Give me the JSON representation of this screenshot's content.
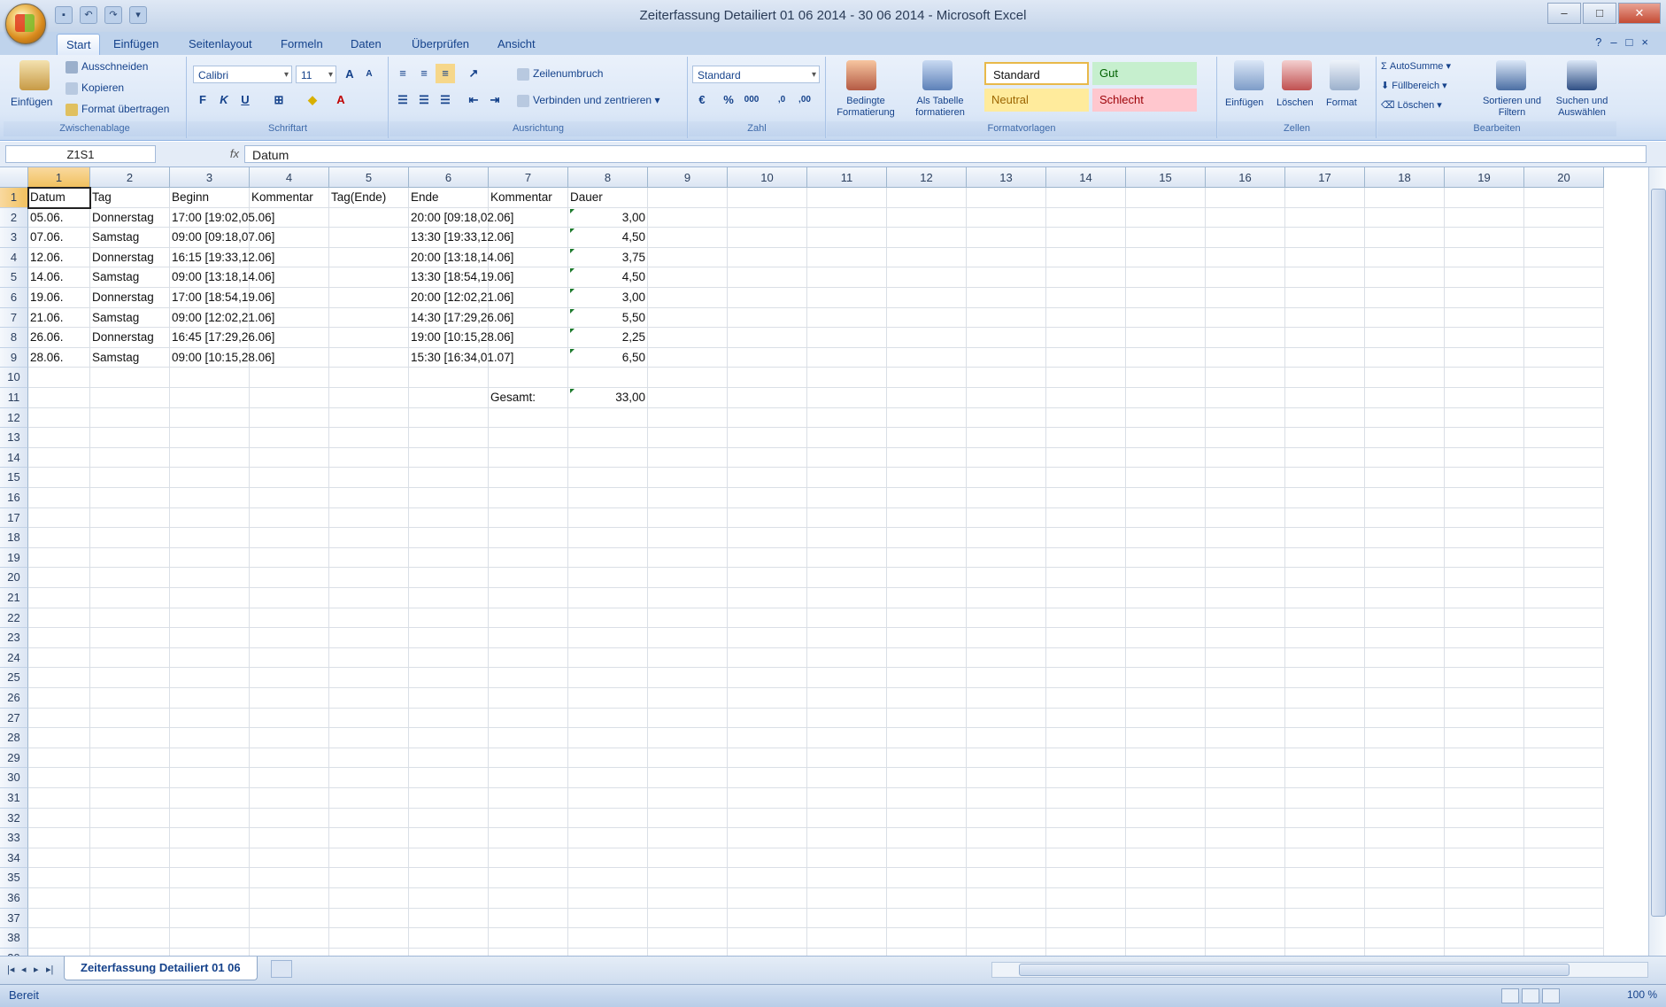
{
  "window": {
    "title": "Zeiterfassung Detailiert 01 06 2014 - 30 06 2014 - Microsoft Excel",
    "controls": [
      "–",
      "□",
      "✕"
    ]
  },
  "tabs": [
    "Start",
    "Einfügen",
    "Seitenlayout",
    "Formeln",
    "Daten",
    "Überprüfen",
    "Ansicht"
  ],
  "ribbon": {
    "clipboard": {
      "paste": "Einfügen",
      "cut": "Ausschneiden",
      "copy": "Kopieren",
      "format_painter": "Format übertragen",
      "label": "Zwischenablage"
    },
    "font": {
      "name": "Calibri",
      "size": "11",
      "bold": "F",
      "italic": "K",
      "underline": "U",
      "label": "Schriftart"
    },
    "alignment": {
      "wrap": "Zeilenumbruch",
      "merge": "Verbinden und zentrieren",
      "label": "Ausrichtung"
    },
    "number": {
      "format": "Standard",
      "percent": "%",
      "thousands": "000",
      "label": "Zahl"
    },
    "styles": {
      "cond_format": "Bedingte Formatierung",
      "as_table": "Als Tabelle formatieren",
      "standard": "Standard",
      "gut": "Gut",
      "neutral": "Neutral",
      "schlecht": "Schlecht",
      "label": "Formatvorlagen"
    },
    "cells": {
      "insert": "Einfügen",
      "delete": "Löschen",
      "format": "Format",
      "label": "Zellen"
    },
    "editing": {
      "autosum": "AutoSumme",
      "fill": "Füllbereich",
      "clear": "Löschen",
      "sort": "Sortieren und Filtern",
      "find": "Suchen und Auswählen",
      "label": "Bearbeiten"
    }
  },
  "formula_bar": {
    "name_box": "Z1S1",
    "fx": "fx",
    "content": "Datum"
  },
  "columns": [
    "1",
    "2",
    "3",
    "4",
    "5",
    "6",
    "7",
    "8",
    "9",
    "10",
    "11",
    "12",
    "13",
    "14",
    "15",
    "16",
    "17",
    "18",
    "19",
    "20"
  ],
  "rows_count": 39,
  "rows": [
    [
      "Datum",
      "Tag",
      "Beginn",
      "Kommentar",
      "Tag(Ende)",
      "Ende",
      "Kommentar",
      "Dauer"
    ],
    [
      "05.06.",
      "Donnerstag",
      "17:00 [19:02,05.06]",
      "",
      "",
      "20:00 [09:18,02.06]",
      "",
      "3,00"
    ],
    [
      "07.06.",
      "Samstag",
      "09:00 [09:18,07.06]",
      "",
      "",
      "13:30 [19:33,12.06]",
      "",
      "4,50"
    ],
    [
      "12.06.",
      "Donnerstag",
      "16:15 [19:33,12.06]",
      "",
      "",
      "20:00 [13:18,14.06]",
      "",
      "3,75"
    ],
    [
      "14.06.",
      "Samstag",
      "09:00 [13:18,14.06]",
      "",
      "",
      "13:30 [18:54,19.06]",
      "",
      "4,50"
    ],
    [
      "19.06.",
      "Donnerstag",
      "17:00 [18:54,19.06]",
      "",
      "",
      "20:00 [12:02,21.06]",
      "",
      "3,00"
    ],
    [
      "21.06.",
      "Samstag",
      "09:00 [12:02,21.06]",
      "",
      "",
      "14:30 [17:29,26.06]",
      "",
      "5,50"
    ],
    [
      "26.06.",
      "Donnerstag",
      "16:45 [17:29,26.06]",
      "",
      "",
      "19:00 [10:15,28.06]",
      "",
      "2,25"
    ],
    [
      "28.06.",
      "Samstag",
      "09:00 [10:15,28.06]",
      "",
      "",
      "15:30 [16:34,01.07]",
      "",
      "6,50"
    ],
    [
      "",
      "",
      "",
      "",
      "",
      "",
      "",
      ""
    ],
    [
      "",
      "",
      "",
      "",
      "",
      "",
      "Gesamt:",
      "33,00"
    ]
  ],
  "sheet": {
    "tab": "Zeiterfassung Detailiert 01 06",
    "nav": [
      "|◂",
      "◂",
      "▸",
      "▸|"
    ]
  },
  "status": {
    "text": "Bereit",
    "zoom": "100 %"
  }
}
